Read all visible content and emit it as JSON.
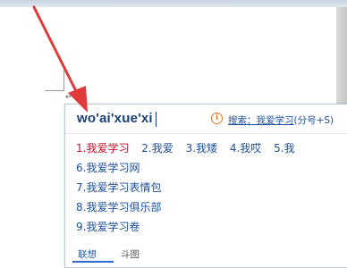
{
  "ime": {
    "pinyin": "wo'ai'xue'xi",
    "search": {
      "label": "搜索：我爱学习",
      "shortcut": "(分号+S)"
    },
    "row_candidates": [
      "1.我爱学习",
      "2.我爱",
      "3.我矮",
      "4.我哎",
      "5.我"
    ],
    "list_candidates": [
      "6.我爱学习网",
      "7.我爱学习表情包",
      "8.我爱学习俱乐部",
      "9.我爱学习卷"
    ],
    "tabs": [
      {
        "label": "联想"
      },
      {
        "label": "斗图"
      }
    ]
  },
  "colors": {
    "selected_candidate": "#c8102e",
    "candidate": "#1e4f9c",
    "annotation_arrow": "#e23a3a"
  },
  "icons": {
    "info": "info-icon",
    "arrow": "red-arrow-annotation"
  }
}
